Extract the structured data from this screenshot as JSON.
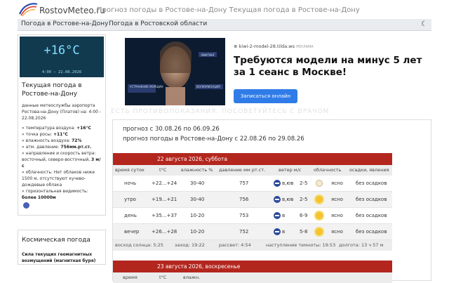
{
  "header": {
    "site_name": "RostovMeteo.ru",
    "tagline": "Прогноз погоды в Ростове-на-Дону  Текущая погода в Ростове-на-Дону",
    "logo_icon": "swoosh-logo-icon"
  },
  "nav": {
    "items": [
      {
        "label": "Погода в Ростове-на-Дону"
      },
      {
        "label": "Погода в Ростовской области"
      }
    ],
    "theme_icon": "moon-icon"
  },
  "current": {
    "temperature": "+16°C",
    "time": "4:00 — 22.08.2026",
    "title": "Текущая погода в Ростове-на-Дону",
    "source": "данные метеослужбы аэропорта Ростова-на-Дону (Платов) на: 4:00 - 22.08.2026",
    "lines": [
      {
        "label": "» температура воздуха: ",
        "value": "+16°C"
      },
      {
        "label": "» точка росы: ",
        "value": "+11°C"
      },
      {
        "label": "» влажность воздуха: ",
        "value": "72%"
      },
      {
        "label": "» атм. давление: ",
        "value": "756мм.рт.ст."
      },
      {
        "label": "» направление и скорость ветра: восточный, северо-восточный, ",
        "value": "3 м/с"
      },
      {
        "label": "» облачность: Нет облаков ниже 1500 м, отсутствуют кучево-дождевые облака",
        "value": ""
      },
      {
        "label": "» горизонтальная видимость: ",
        "value": "более 10000м"
      }
    ]
  },
  "cosmic": {
    "title": "Космическая погода",
    "text": "Сила текущих геомагнитных возмущений (магнитная буря)"
  },
  "ad": {
    "domain": "kiwi-2-model-28.tilda.ws",
    "reklama": "РЕКЛАМА",
    "headline": "Требуются модели на минус 5 лет за 1 сеанс в Москве!",
    "button": "Записаться онлайн",
    "img_labels": [
      "ЛИФТИНГ",
      "УСТРАНЕНИЕ МОРЩИН",
      "ВОЛЮМИЗАЦИЯ"
    ],
    "disclaimer": "ЕСТЬ ПРОТИВОПОКАЗАНИЯ. ПОСОВЕТУЙТЕСЬ С ВРАЧОМ"
  },
  "forecast": {
    "range1": "прогноз с 30.08.26 по 06.09.26",
    "range2": "прогноз погоды в Ростове-на-Дону с 22.08.26 по 29.08.26",
    "columns": [
      "время суток",
      "t°C",
      "влажность %",
      "давление мм рт.ст.",
      "ветер м/с",
      "облачность",
      "осадки, явления"
    ],
    "days": [
      {
        "title": "22 августа 2026, суббота",
        "rows": [
          {
            "time": "ночь",
            "temp": "+22...+24",
            "hum": "30-40",
            "press": "757",
            "wind_dir": "в,юв",
            "wind": "2-5",
            "cloud_icon": "moon-icon",
            "cloud": "ясно",
            "precip": "без осадков"
          },
          {
            "time": "утро",
            "temp": "+19...+21",
            "hum": "30-40",
            "press": "756",
            "wind_dir": "в,юв",
            "wind": "2-5",
            "cloud_icon": "sun-icon",
            "cloud": "ясно",
            "precip": "без осадков"
          },
          {
            "time": "день",
            "temp": "+35...+37",
            "hum": "10-20",
            "press": "753",
            "wind_dir": "в",
            "wind": "6-9",
            "cloud_icon": "sun-icon",
            "cloud": "ясно",
            "precip": "без осадков"
          },
          {
            "time": "вечер",
            "temp": "+26...+28",
            "hum": "10-20",
            "press": "752",
            "wind_dir": "в",
            "wind": "5-8",
            "cloud_icon": "sun-icon",
            "cloud": "ясно",
            "precip": "без осадков"
          }
        ],
        "sun": {
          "sunrise": "восход солнца: 5:25",
          "sunset": "заход: 19:22",
          "dawn": "рассвет: 4:54",
          "dusk": "наступление темноты: 19:53",
          "daylength": "долгота: 13 ч 57 м"
        }
      },
      {
        "title": "23 августа 2026, воскресенье",
        "columns_partial": [
          "время",
          "t°C",
          "влажн."
        ]
      }
    ]
  }
}
